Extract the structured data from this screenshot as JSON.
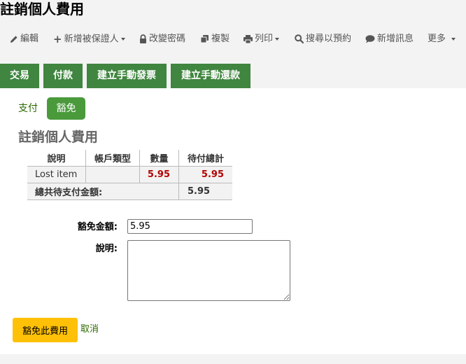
{
  "page": {
    "title": "註銷個人費用"
  },
  "toolbar": {
    "edit": "編輯",
    "add_guarantee": "新增被保證人",
    "change_password": "改變密碼",
    "duplicate": "複製",
    "print": "列印",
    "search_holds": "搜尋以預約",
    "new_message": "新增訊息",
    "more": "更多"
  },
  "tabs": {
    "transactions": "交易",
    "payment": "付款",
    "manual_invoice": "建立手動發票",
    "manual_credit": "建立手動還款"
  },
  "subtabs": {
    "pay": "支付",
    "waive": "豁免"
  },
  "section": {
    "title": "註銷個人費用"
  },
  "table": {
    "headers": [
      "說明",
      "帳戶類型",
      "數量",
      "待付總計"
    ],
    "row": {
      "description": "Lost item",
      "account_type": "",
      "amount": "5.95",
      "outstanding": "5.95"
    },
    "total_label": "總共待支付金額:",
    "total_value": "5.95"
  },
  "form": {
    "amount_label": "豁免金額:",
    "amount_value": "5.95",
    "note_label": "說明:",
    "submit_label": "豁免此費用",
    "cancel_label": "取消"
  },
  "colors": {
    "tab_green": "#408540",
    "active_pill": "#4a9a3c",
    "link_green": "#2d6a00",
    "submit_yellow": "#ffc107",
    "amount_red": "#b30000"
  }
}
